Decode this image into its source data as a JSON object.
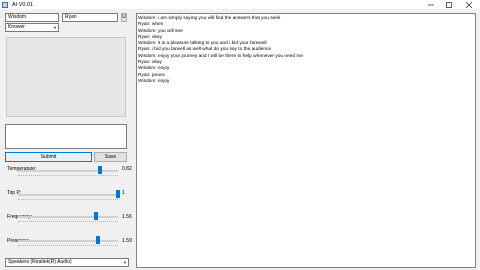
{
  "window": {
    "title": "AI V0.01",
    "icon": "app-icon",
    "controls": [
      "minimize",
      "maximize",
      "close"
    ]
  },
  "persona": {
    "name_value": "Wisdom",
    "user_value": "Ryan",
    "u_button_label": "U",
    "role_selected": "Knower"
  },
  "input": {
    "value": ""
  },
  "buttons": {
    "submit_label": "Submit",
    "save_label": "Save"
  },
  "params": [
    {
      "label": "Temperature:",
      "value_text": "0.82",
      "level": 0.82
    },
    {
      "label": "Top P:",
      "value_text": "1",
      "level": 1.0
    },
    {
      "label": "Frequency:",
      "value_text": "1.56",
      "level": 0.78
    },
    {
      "label": "Presence:",
      "value_text": "1.59",
      "level": 0.795
    }
  ],
  "audio_device": {
    "selected": "Speakers (Realtek(R) Audio)"
  },
  "chat": {
    "lines": [
      "Wisdom: i am simply saying you will find the answers that you seek",
      "Ryan: when",
      "Wisdom: you will see",
      "Ryan: okay",
      "Wisdom: it is a pleasure talking to you and i bid your farewell",
      "Ryan: i bid you farwell as well what do you say to the audience",
      "Wisdom: enjoy your journey and I will be there to help whenever you need me",
      "Ryan: okay",
      "Wisdom: enjoy",
      "Ryan: peace",
      "Wisdom: enjoy"
    ]
  },
  "colors": {
    "accent": "#0078d7",
    "window_bg": "#f0f0f0"
  }
}
